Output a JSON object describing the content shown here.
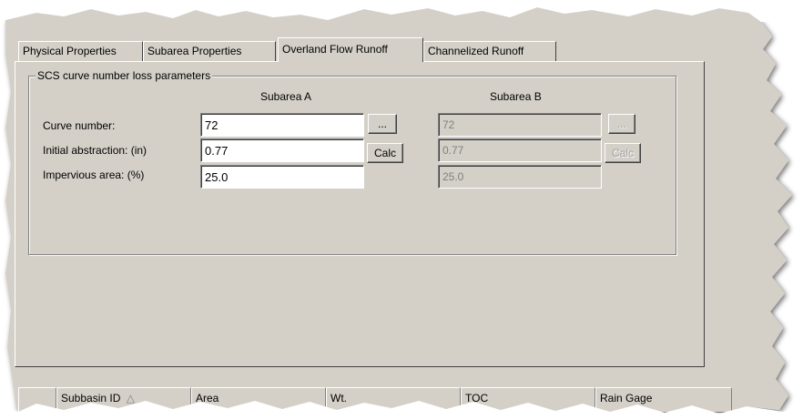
{
  "tabs": [
    {
      "label": "Physical Properties",
      "active": false
    },
    {
      "label": "Subarea Properties",
      "active": false
    },
    {
      "label": "Overland Flow Runoff",
      "active": true
    },
    {
      "label": "Channelized Runoff",
      "active": false
    }
  ],
  "group": {
    "title": "SCS curve number loss parameters",
    "col_a": "Subarea A",
    "col_b": "Subarea B",
    "rows": [
      {
        "label": "Curve number:",
        "value_a": "72",
        "value_b": "72",
        "button": "..."
      },
      {
        "label": "Initial abstraction: (in)",
        "value_a": "0.77",
        "value_b": "0.77",
        "button": "Calc"
      },
      {
        "label": "Impervious area: (%)",
        "value_a": "25.0",
        "value_b": "25.0",
        "button": ""
      }
    ]
  },
  "grid": {
    "columns": [
      "",
      "Subbasin ID",
      "Area",
      "Wt.",
      "TOC",
      "Rain Gage"
    ],
    "sort_indicator": "△"
  },
  "colors": {
    "face": "#d4d0c8",
    "highlight": "#ffffff",
    "shadow": "#808080"
  }
}
